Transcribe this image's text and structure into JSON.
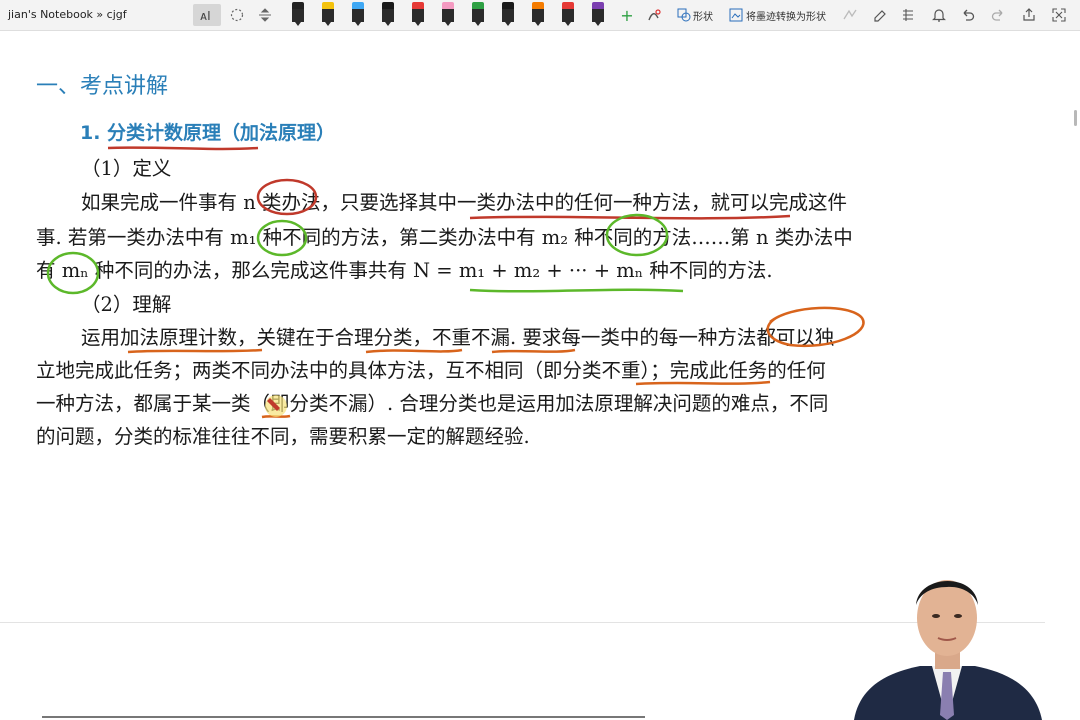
{
  "window": {
    "breadcrumb": "jian's Notebook » cjgf"
  },
  "toolbar": {
    "shape_label": "形状",
    "ink_to_shape_label": "将墨迹转换为形状",
    "pen_colors": [
      "#222222",
      "#f4c20d",
      "#3fa8f4",
      "#1a1a1a",
      "#e53935",
      "#f49ac1",
      "#2ea043",
      "#1a1a1a",
      "#f57c00",
      "#e53935",
      "#7b3fb0"
    ]
  },
  "document": {
    "heading1": "一、考点讲解",
    "heading2": "1.  分类计数原理（加法原理）",
    "def_title": "（1）定义",
    "def_lines": [
      "如果完成一件事有 n 类办法，只要选择其中一类办法中的任何一种方法，就可以完成这件",
      "事. 若第一类办法中有 m₁ 种不同的方法，第二类办法中有 m₂ 种不同的方法……第 n 类办法中",
      "有 mₙ 种不同的办法，那么完成这件事共有 N = m₁ + m₂ + ··· + mₙ 种不同的方法."
    ],
    "und_title": "（2）理解",
    "und_lines": [
      "运用加法原理计数，关键在于合理分类，不重不漏. 要求每一类中的每一种方法都可以独",
      "立地完成此任务；两类不同办法中的具体方法，互不相同（即分类不重）；完成此任务的任何",
      "一种方法，都属于某一类（即分类不漏）. 合理分类也是运用加法原理解决问题的难点，不同",
      "的问题，分类的标准往往不同，需要积累一定的解题经验."
    ]
  },
  "colors": {
    "heading": "#2a7fb8",
    "ink_red": "#c0392b",
    "ink_green": "#5cb82a",
    "ink_orange": "#d8641c"
  }
}
